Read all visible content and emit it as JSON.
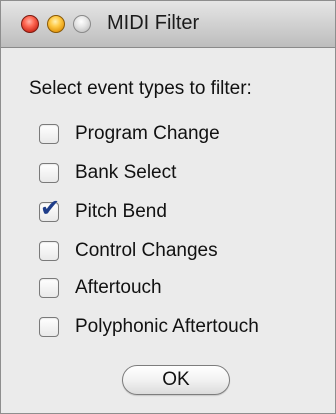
{
  "window": {
    "title": "MIDI Filter",
    "controls": [
      "close-icon",
      "minimize-icon",
      "zoom-icon"
    ]
  },
  "prompt": "Select event types to filter:",
  "options": [
    {
      "label": "Program Change",
      "checked": false
    },
    {
      "label": "Bank Select",
      "checked": false
    },
    {
      "label": "Pitch Bend",
      "checked": true
    },
    {
      "label": "Control Changes",
      "checked": false
    },
    {
      "label": "Aftertouch",
      "checked": false
    },
    {
      "label": "Polyphonic Aftertouch",
      "checked": false
    }
  ],
  "ok_button": {
    "label": "OK"
  },
  "colors": {
    "checkmark": "#1f3e8a",
    "close": "#ff5f57",
    "minimize": "#ffbd2e",
    "zoom": "#c8c8c8"
  }
}
